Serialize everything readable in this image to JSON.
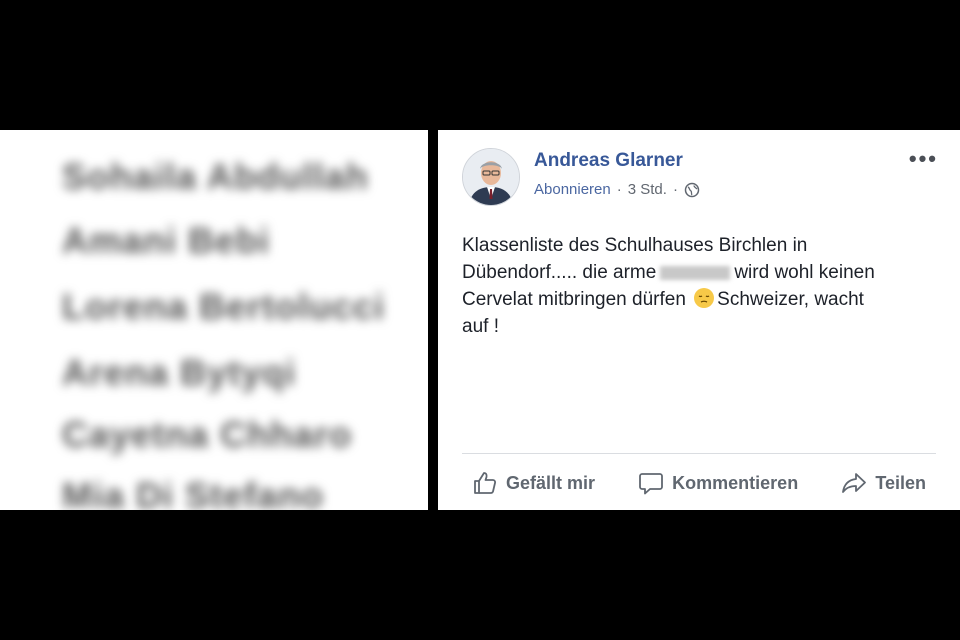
{
  "left_list": {
    "names": [
      "Sohaila Abdullah",
      "Amani Bebi",
      "Lorena Bertolucci",
      "Arena Bytyqi",
      "Cayetna Chharo",
      "Mia Di Stefano"
    ]
  },
  "post": {
    "author": "Andreas Glarner",
    "follow_label": "Abonnieren",
    "separator": "·",
    "time": "3 Std.",
    "separator2": "·",
    "text_line1": "Klassenliste des Schulhauses Birchlen in",
    "text_line2a": "Dübendorf..... die arme",
    "text_line2b": "wird wohl keinen",
    "text_line3a": "Cervelat mitbringen dürfen",
    "text_line3b": "Schweizer, wacht",
    "text_line4": "auf !",
    "more_label": "•••"
  },
  "actions": {
    "like_label": "Gefällt mir",
    "comment_label": "Kommentieren",
    "share_label": "Teilen"
  },
  "colors": {
    "author": "#385898",
    "meta": "#616770",
    "text": "#1d2129",
    "action": "#606770"
  },
  "icons": [
    "globe-icon",
    "more-icon",
    "like-icon",
    "comment-icon",
    "share-icon",
    "sad-emoji-icon"
  ]
}
